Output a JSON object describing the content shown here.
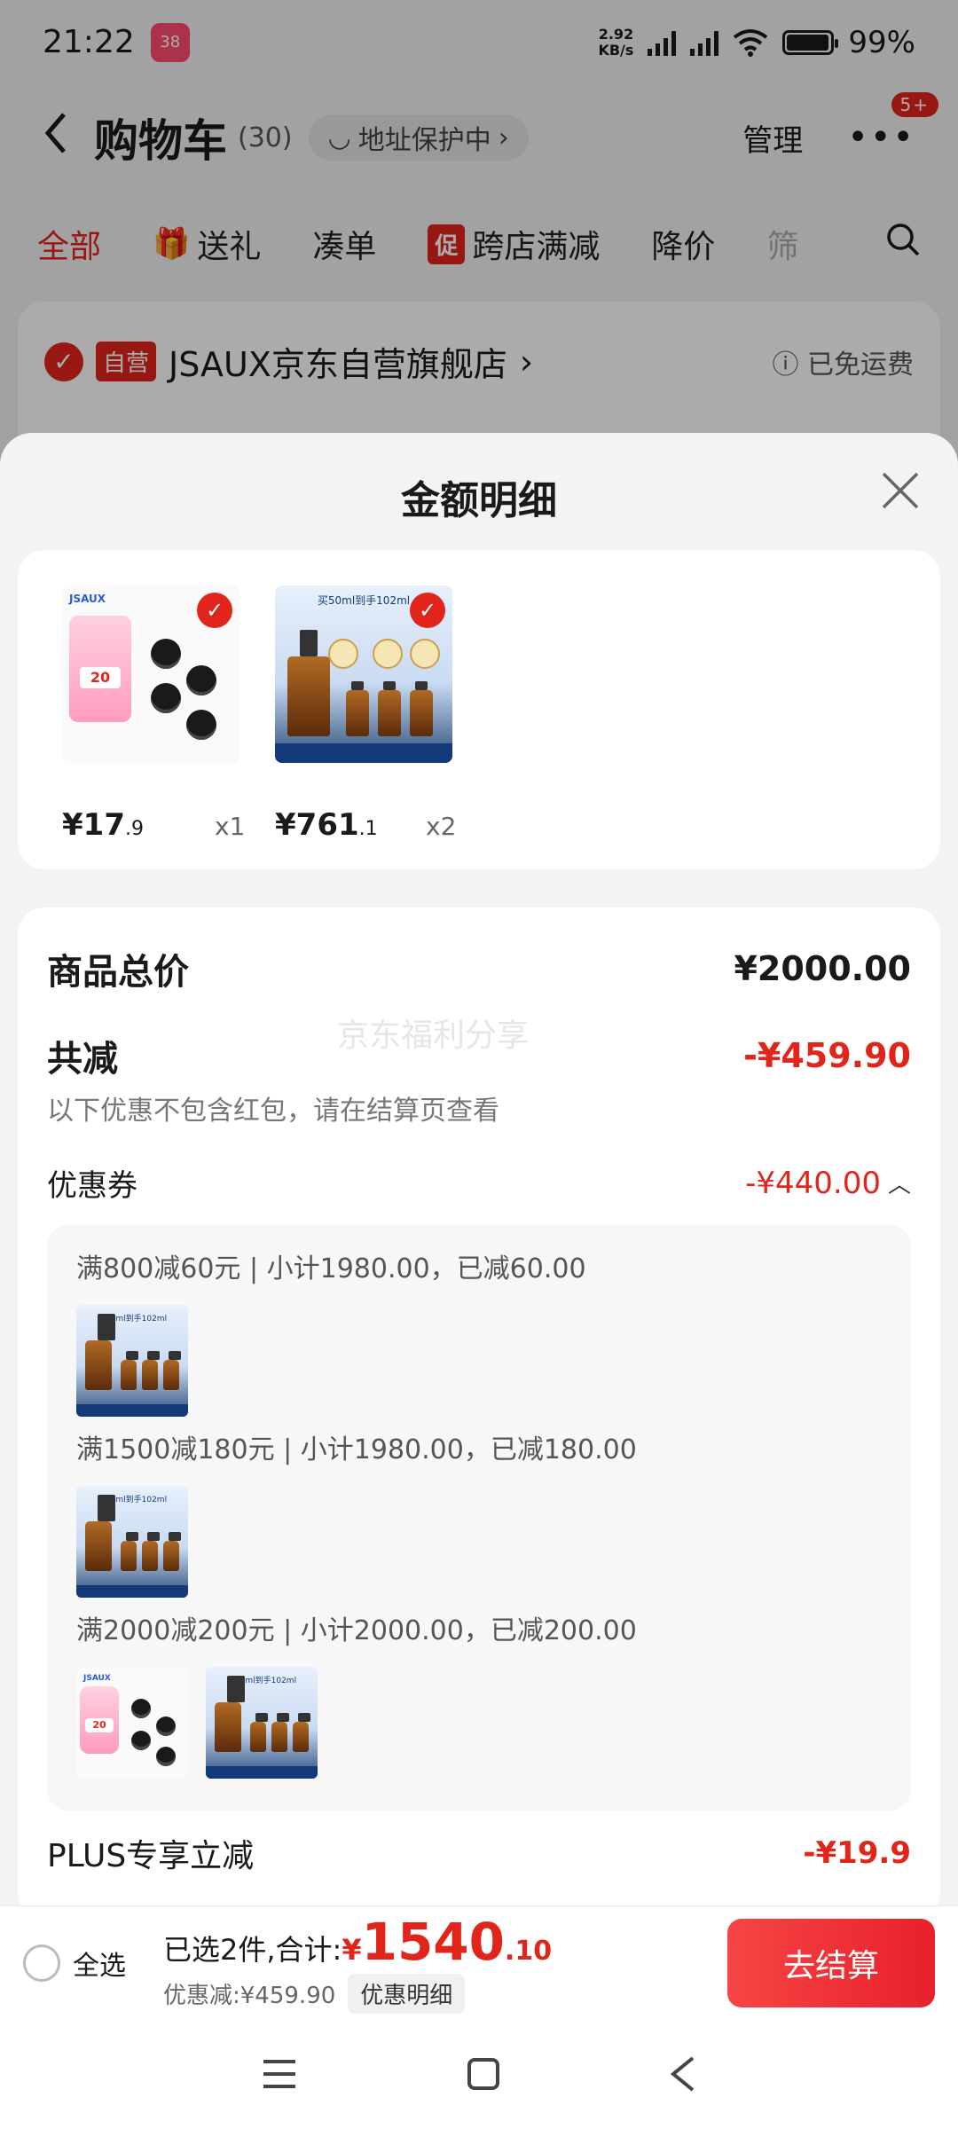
{
  "status_bar": {
    "time": "21:22",
    "net_speed_top": "2.92",
    "net_speed_bottom": "KB/s",
    "battery": "99%"
  },
  "header": {
    "back_icon": "chevron-left-icon",
    "title": "购物车",
    "count": "(30)",
    "address_protect": "地址保护中",
    "manage": "管理",
    "more_badge": "5+"
  },
  "tabs": [
    {
      "label": "全部",
      "active": true
    },
    {
      "label": "送礼"
    },
    {
      "label": "凑单"
    },
    {
      "label": "跨店满减",
      "tag": "促"
    },
    {
      "label": "降价"
    },
    {
      "label": "筛"
    }
  ],
  "store": {
    "tag": "自营",
    "name": "JSAUX京东自营旗舰店",
    "shipping": "已免运费"
  },
  "sheet": {
    "title": "金额明细",
    "items": [
      {
        "price_main": "¥17",
        "price_dec": ".9",
        "qty": "x1",
        "thumb": "jsaux",
        "card_value": "20"
      },
      {
        "price_main": "¥761",
        "price_dec": ".1",
        "qty": "x2",
        "thumb": "estee",
        "card_text": "买50ml到手102ml"
      }
    ],
    "total_label": "商品总价",
    "total_value": "¥2000.00",
    "save_label": "共减",
    "save_value": "-¥459.90",
    "note": "以下优惠不包含红包，请在结算页查看",
    "watermark": "京东福利分享",
    "coupon_label": "优惠券",
    "coupon_value": "-¥440.00",
    "coupons": [
      {
        "text": "满800减60元 | 小计1980.00，已减60.00",
        "thumbs": [
          "estee"
        ]
      },
      {
        "text": "满1500减180元 | 小计1980.00，已减180.00",
        "thumbs": [
          "estee"
        ]
      },
      {
        "text": "满2000减200元 | 小计2000.00，已减200.00",
        "thumbs": [
          "jsaux",
          "estee"
        ]
      }
    ],
    "plus_label": "PLUS专享立减",
    "plus_value": "-¥19.9"
  },
  "bottom_bar": {
    "select_all": "全选",
    "selected": "已选2件,合计:",
    "currency": "¥",
    "total_main": "1540",
    "total_dec": ".10",
    "discount": "优惠减:¥459.90",
    "detail_btn": "优惠明细",
    "checkout": "去结算"
  },
  "colors": {
    "accent": "#e1251b",
    "checkout_start": "#f74545",
    "checkout_end": "#e8202a"
  }
}
